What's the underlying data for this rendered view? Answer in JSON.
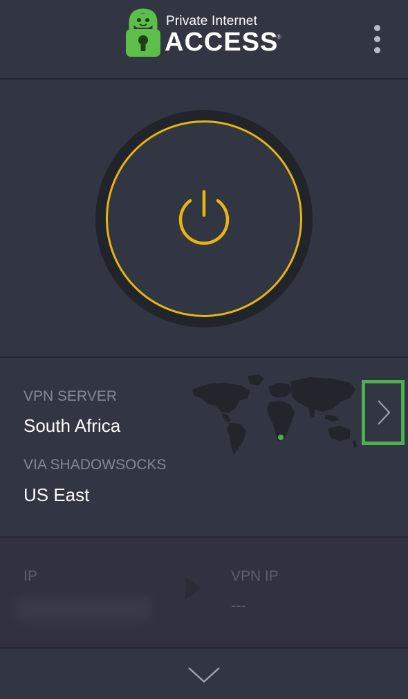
{
  "header": {
    "logo_small": "Private Internet",
    "logo_big": "ACCESS",
    "logo_reg": "®",
    "menu_icon": "more-vertical-icon"
  },
  "power": {
    "state_color": "#e6b512",
    "icon": "power-icon"
  },
  "region": {
    "server_label": "VPN SERVER",
    "server_value": "South Africa",
    "proxy_label": "VIA SHADOWSOCKS",
    "proxy_value": "US East",
    "map_marker_color": "#4caf50",
    "chevron_icon": "chevron-right-icon"
  },
  "ip": {
    "ip_label": "IP",
    "vpn_ip_label": "VPN IP",
    "vpn_ip_value": "---"
  },
  "footer": {
    "expand_icon": "chevron-down-icon"
  },
  "colors": {
    "accent_yellow": "#e6b512",
    "highlight_green": "#4caf50",
    "background": "#323542"
  }
}
